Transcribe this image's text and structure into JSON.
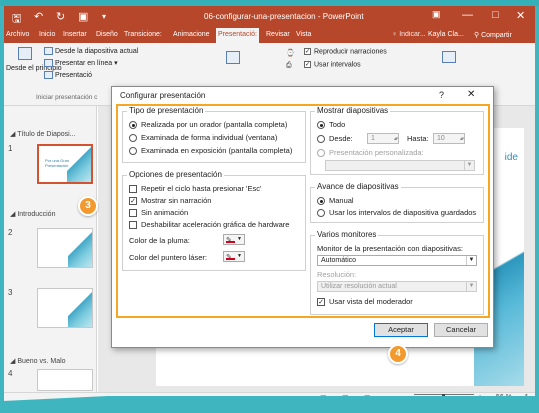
{
  "window": {
    "title": "06-configurar-una-presentacion - PowerPoint",
    "minimize": "—",
    "maximize": "□",
    "close": "✕"
  },
  "menu": {
    "tabs": [
      "Archivo",
      "Inicio",
      "Insertar",
      "Diseño",
      "Transicione:",
      "Animacione",
      "Presentació:",
      "Revisar",
      "Vista"
    ],
    "active_tab": "Presentació:",
    "tell_me": "♀ Indicar...",
    "user": "Kayla Cla...",
    "share": "Compartir"
  },
  "ribbon": {
    "desde_actual": "Desde la diapositiva actual",
    "presentar_linea": "Presentar en línea",
    "presentacion_pers": "Presentació",
    "desde_el_principio": "Desde el principio",
    "group_label": "Iniciar presentación c",
    "reproducir_narraciones": "Reproducir narraciones",
    "usar_intervalos": "Usar intervalos"
  },
  "pane": {
    "section1": "Título de Diaposi...",
    "section2": "Introducción",
    "section3": "Bueno vs. Malo",
    "thumb1_title": "Por una Gran Presentación",
    "slide_nums": [
      "1",
      "2",
      "3",
      "4"
    ]
  },
  "slide": {
    "side_text": "ide"
  },
  "status": {
    "zoom": "56 %"
  },
  "dialog": {
    "title": "Configurar presentación",
    "help": "?",
    "close": "✕",
    "tipo": {
      "title": "Tipo de presentación",
      "options": [
        "Realizada por un orador (pantalla completa)",
        "Examinada de forma individual (ventana)",
        "Examinada en exposición (pantalla completa)"
      ],
      "selected_index": 0
    },
    "opciones": {
      "title": "Opciones de presentación",
      "checks": [
        {
          "label": "Repetir el ciclo hasta presionar 'Esc'",
          "checked": false
        },
        {
          "label": "Mostrar sin narración",
          "checked": true
        },
        {
          "label": "Sin animación",
          "checked": false
        },
        {
          "label": "Deshabilitar aceleración gráfica de hardware",
          "checked": false
        }
      ],
      "color_pluma": "Color de la pluma:",
      "color_puntero": "Color del puntero láser:"
    },
    "mostrar": {
      "title": "Mostrar diapositivas",
      "todo": "Todo",
      "desde": "Desde:",
      "desde_val": "1",
      "hasta": "Hasta:",
      "hasta_val": "10",
      "personalizada": "Presentación personalizada:"
    },
    "avance": {
      "title": "Avance de diapositivas",
      "manual": "Manual",
      "intervalos": "Usar los intervalos de diapositiva guardados"
    },
    "monitores": {
      "title": "Varios monitores",
      "monitor_label": "Monitor de la presentación con diapositivas:",
      "monitor_value": "Automático",
      "resolucion_label": "Resolución:",
      "resolucion_value": "Utilizar resolución actual",
      "vista_moderador": "Usar vista del moderador"
    },
    "ok": "Aceptar",
    "cancel": "Cancelar"
  },
  "badges": [
    "3",
    "4"
  ],
  "colors": {
    "accent": "#b7472a",
    "highlight": "#f5a623",
    "badge": "#f39a2f",
    "background": "#3fb6bf"
  }
}
